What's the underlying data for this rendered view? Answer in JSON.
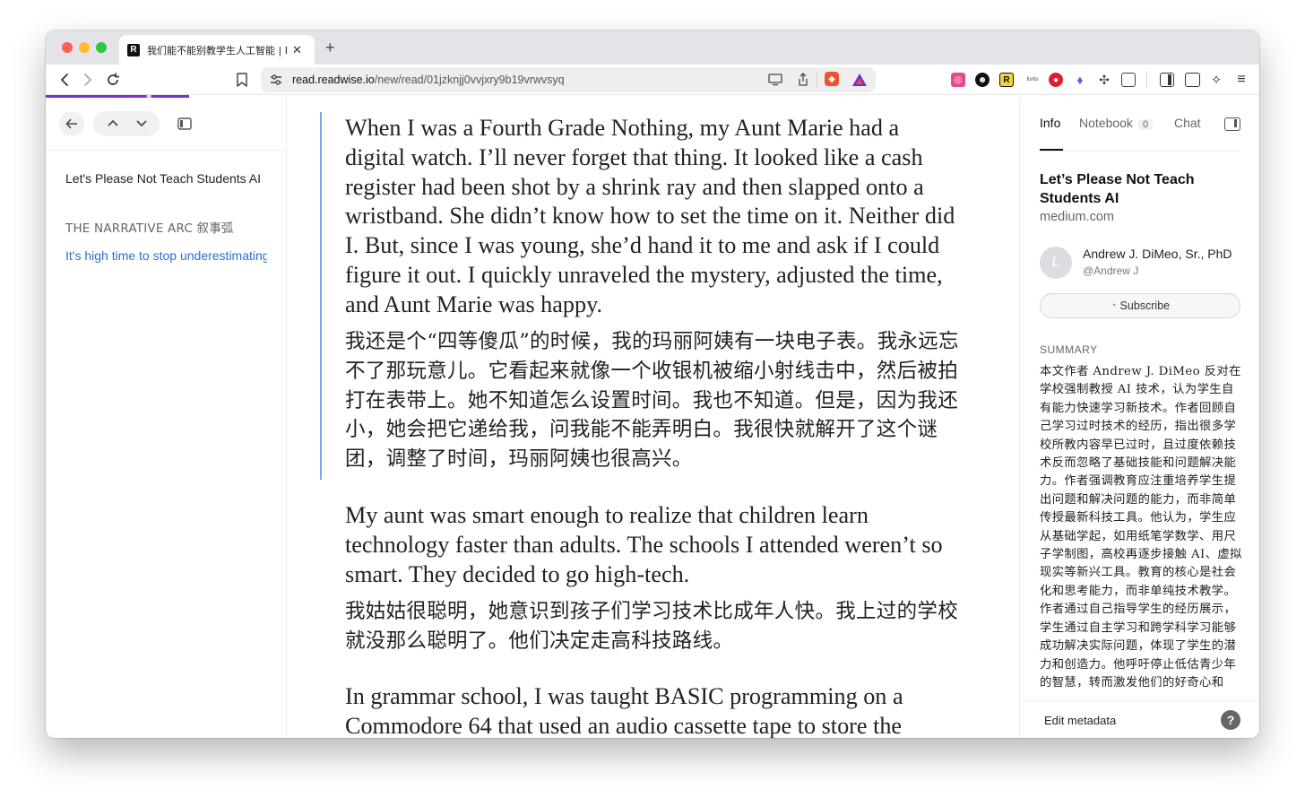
{
  "browser": {
    "tab_title": "我们能不能别教学生人工智能 | R",
    "tab_favicon": "R",
    "tab_close": "✕",
    "new_tab": "+",
    "url_host": "read.readwise.io",
    "url_path": "/new/read/01jzknjj0vvjxry9b19vrwvsyq",
    "icons": [
      "back-icon",
      "forward-icon",
      "reload-icon",
      "bookmark-icon",
      "site-settings-icon",
      "cast-icon",
      "share-icon",
      "brave-shields-icon",
      "brave-rewards-icon",
      "extensions-icon",
      "sidebar-icon",
      "wallet-icon",
      "leo-icon",
      "menu-icon"
    ]
  },
  "left_panel": {
    "doc_title": "Let's Please Not Teach Students AI",
    "section": "THE NARRATIVE ARC  叙事弧",
    "active_link": "It's high time to stop underestimating students"
  },
  "reader": {
    "p1_en": "When I was a Fourth Grade Nothing, my Aunt Marie had a digital watch. I’ll never forget that thing. It looked like a cash register had been shot by a shrink ray and then slapped onto a wristband. She didn’t know how to set the time on it. Neither did I. But, since I was young, she’d hand it to me and ask if I could figure it out. I quickly unraveled the mystery, adjusted the time, and Aunt Marie was happy.",
    "p1_zh": "我还是个“四等傻瓜”的时候，我的玛丽阿姨有一块电子表。我永远忘不了那玩意儿。它看起来就像一个收银机被缩小射线击中，然后被拍打在表带上。她不知道怎么设置时间。我也不知道。但是，因为我还小，她会把它递给我，问我能不能弄明白。我很快就解开了这个谜团，调整了时间，玛丽阿姨也很高兴。",
    "p2_en": "My aunt was smart enough to realize that children learn technology faster than adults. The schools I attended weren’t so smart. They decided to go high-tech.",
    "p2_zh": "我姑姑很聪明，她意识到孩子们学习技术比成年人快。我上过的学校就没那么聪明了。他们决定走高科技路线。",
    "p3_en": "In grammar school, I was taught BASIC programming on a Commodore 64 that used an audio cassette tape to store the"
  },
  "right_panel": {
    "tabs": {
      "info": "Info",
      "notebook": "Notebook",
      "notebook_count": "0",
      "chat": "Chat"
    },
    "title": "Let’s Please Not Teach Students AI",
    "domain": "medium.com",
    "avatar_letter": "L",
    "author_name": "Andrew J. DiMeo, Sr., PhD",
    "author_handle": "@Andrew J",
    "subscribe": "Subscribe",
    "summary_label": "SUMMARY",
    "summary": "本文作者 Andrew J. DiMeo 反对在学校强制教授 AI 技术，认为学生自有能力快速学习新技术。作者回顾自己学习过时技术的经历，指出很多学校所教内容早已过时，且过度依赖技术反而忽略了基础技能和问题解决能力。作者强调教育应注重培养学生提出问题和解决问题的能力，而非简单传授最新科技工具。他认为，学生应从基础学起，如用纸笔学数学、用尺子学制图，高校再逐步接触 AI、虚拟现实等新兴工具。教育的核心是社会化和思考能力，而非单纯技术教学。作者通过自己指导学生的经历展示，学生通过自主学习和跨学科学习能够成功解决实际问题，体现了学生的潜力和创造力。他呼吁停止低估青少年的智慧，转而激发他们的好奇心和",
    "edit_metadata": "Edit metadata",
    "help": "?"
  }
}
